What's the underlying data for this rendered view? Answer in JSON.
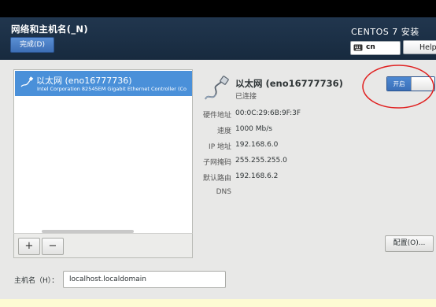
{
  "header": {
    "title": "网络和主机名(_N)",
    "done_label": "完成(D)",
    "product_title": "CENTOS 7 安装",
    "keyboard_layout": "cn",
    "help_label": "Help!"
  },
  "device_list": {
    "items": [
      {
        "name": "以太网 (eno16777736)",
        "description": "Intel Corporation 82545EM Gigabit Ethernet Controller (Co"
      }
    ],
    "add_label": "+",
    "remove_label": "−"
  },
  "detail": {
    "name": "以太网 (eno16777736)",
    "status": "已连接",
    "toggle_label": "开启",
    "properties": [
      {
        "label": "硬件地址",
        "value": "00:0C:29:6B:9F:3F"
      },
      {
        "label": "速度",
        "value": "1000 Mb/s"
      },
      {
        "label": "IP 地址",
        "value": "192.168.6.0"
      },
      {
        "label": "子网掩码",
        "value": "255.255.255.0"
      },
      {
        "label": "默认路由",
        "value": "192.168.6.2"
      },
      {
        "label": "DNS",
        "value": ""
      }
    ],
    "configure_label": "配置(O)..."
  },
  "hostname": {
    "label": "主机名（H）：",
    "value": "localhost.localdomain"
  },
  "icons": {
    "keyboard": "keyboard-icon",
    "device": "ethernet-cable-icon"
  },
  "colors": {
    "header_bg": "#1b2f45",
    "accent": "#4a90d9",
    "annotation": "#e02020"
  }
}
